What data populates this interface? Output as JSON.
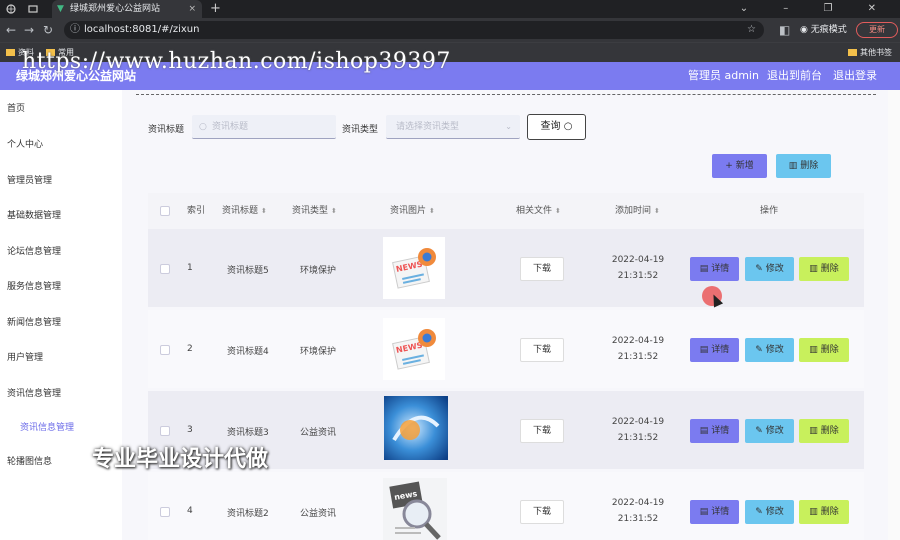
{
  "browser": {
    "tab_title": "绿城郑州爱心公益网站",
    "url": "localhost:8081/#/zixun",
    "incognito_label": "无痕模式",
    "update_label": "更新",
    "bookmarks": [
      "资料",
      "常用"
    ],
    "other_bookmarks": "其他书签"
  },
  "watermark": "https://www.huzhan.com/ishop39397",
  "overlay_ad": "专业毕业设计代做",
  "header": {
    "title": "绿城郑州爱心公益网站",
    "admin": "管理员 admin",
    "front": "退出到前台",
    "logout": "退出登录"
  },
  "sidebar": {
    "items": [
      "首页",
      "个人中心",
      "管理员管理",
      "基础数据管理",
      "论坛信息管理",
      "服务信息管理",
      "新闻信息管理",
      "用户管理",
      "资讯信息管理",
      "资讯信息管理",
      "轮播图信息"
    ]
  },
  "filters": {
    "title_label": "资讯标题",
    "title_placeholder": "资讯标题",
    "type_label": "资讯类型",
    "type_placeholder": "请选择资讯类型",
    "query": "查询"
  },
  "actions": {
    "add": "新增",
    "delete": "删除"
  },
  "table": {
    "headers": [
      "索引",
      "资讯标题",
      "资讯类型",
      "资讯图片",
      "相关文件",
      "添加时间",
      "操作"
    ],
    "download_label": "下载",
    "detail_label": "详情",
    "edit_label": "修改",
    "delete_label": "删除",
    "rows": [
      {
        "index": "1",
        "title": "资讯标题5",
        "type": "环境保护",
        "date": "2022-04-19",
        "time": "21:31:52"
      },
      {
        "index": "2",
        "title": "资讯标题4",
        "type": "环境保护",
        "date": "2022-04-19",
        "time": "21:31:52"
      },
      {
        "index": "3",
        "title": "资讯标题3",
        "type": "公益资讯",
        "date": "2022-04-19",
        "time": "21:31:52"
      },
      {
        "index": "4",
        "title": "资讯标题2",
        "type": "公益资讯",
        "date": "2022-04-19",
        "time": "21:31:52"
      }
    ]
  },
  "colors": {
    "primary": "#7b7bf0",
    "info": "#6bc6ef",
    "warn": "#c8f05c"
  }
}
